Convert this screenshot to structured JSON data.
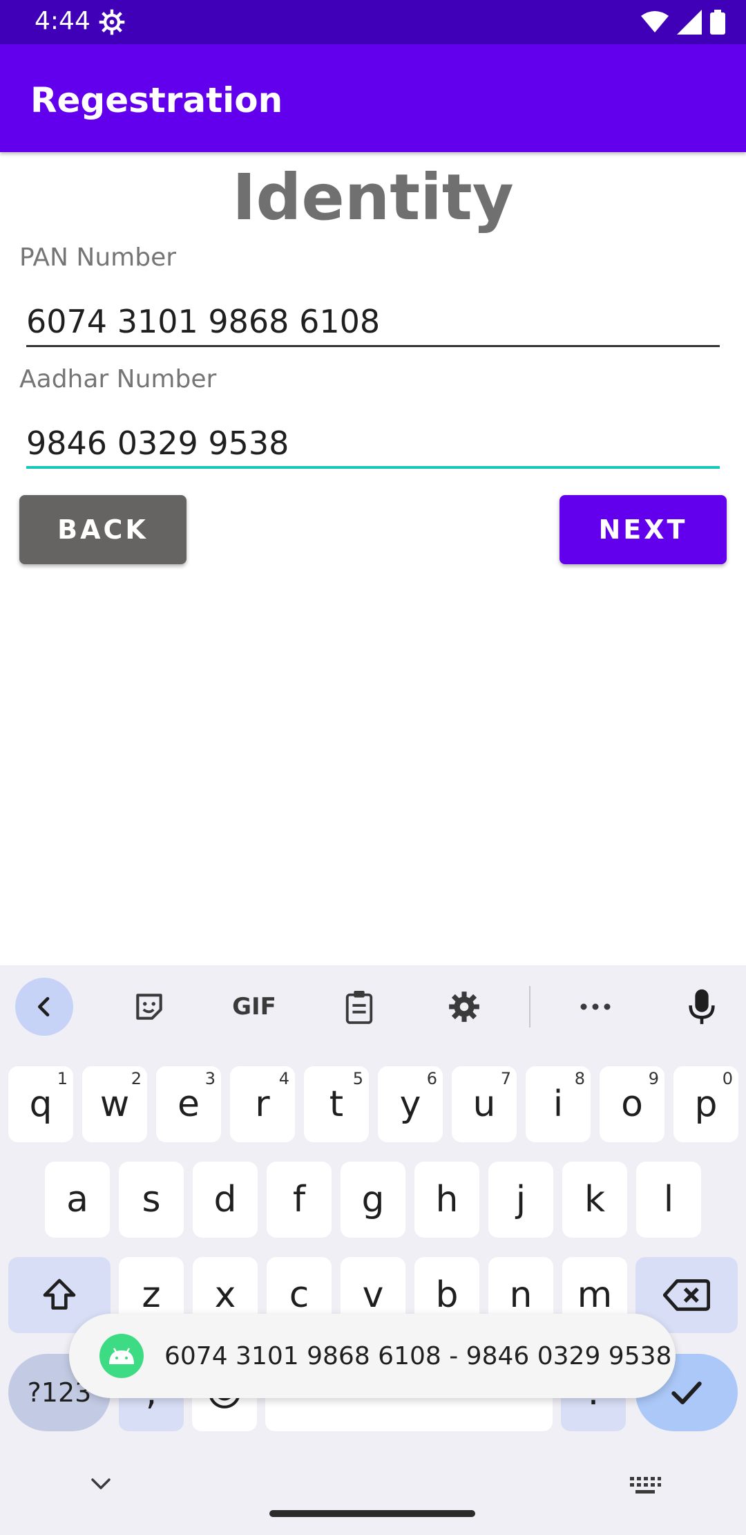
{
  "status_bar": {
    "time": "4:44"
  },
  "app_bar": {
    "title": "Regestration"
  },
  "screen": {
    "heading": "Identity",
    "pan_label": "PAN Number",
    "pan_value": "6074 3101 9868 6108",
    "aadhar_label": "Aadhar Number",
    "aadhar_value": "9846 0329 9538",
    "back_label": "BACK",
    "next_label": "NEXT"
  },
  "keyboard": {
    "toolbar": [
      "collapse-icon",
      "sticker-icon",
      "gif-icon",
      "clipboard-icon",
      "gear-icon",
      "more-icon",
      "mic-icon"
    ],
    "gif_label": "GIF",
    "row1": [
      {
        "ch": "q",
        "hint": "1"
      },
      {
        "ch": "w",
        "hint": "2"
      },
      {
        "ch": "e",
        "hint": "3"
      },
      {
        "ch": "r",
        "hint": "4"
      },
      {
        "ch": "t",
        "hint": "5"
      },
      {
        "ch": "y",
        "hint": "6"
      },
      {
        "ch": "u",
        "hint": "7"
      },
      {
        "ch": "i",
        "hint": "8"
      },
      {
        "ch": "o",
        "hint": "9"
      },
      {
        "ch": "p",
        "hint": "0"
      }
    ],
    "row2": [
      "a",
      "s",
      "d",
      "f",
      "g",
      "h",
      "j",
      "k",
      "l"
    ],
    "row3": [
      "z",
      "x",
      "c",
      "v",
      "b",
      "n",
      "m"
    ],
    "symbols_label": "?123",
    "comma": ",",
    "period": "."
  },
  "toast": {
    "text": "6074 3101 9868 6108 - 9846 0329 9538"
  },
  "colors": {
    "status_bar": "#4000b8",
    "app_bar": "#6200ee",
    "focus_underline": "#17c8b8",
    "back_button": "#666462"
  }
}
